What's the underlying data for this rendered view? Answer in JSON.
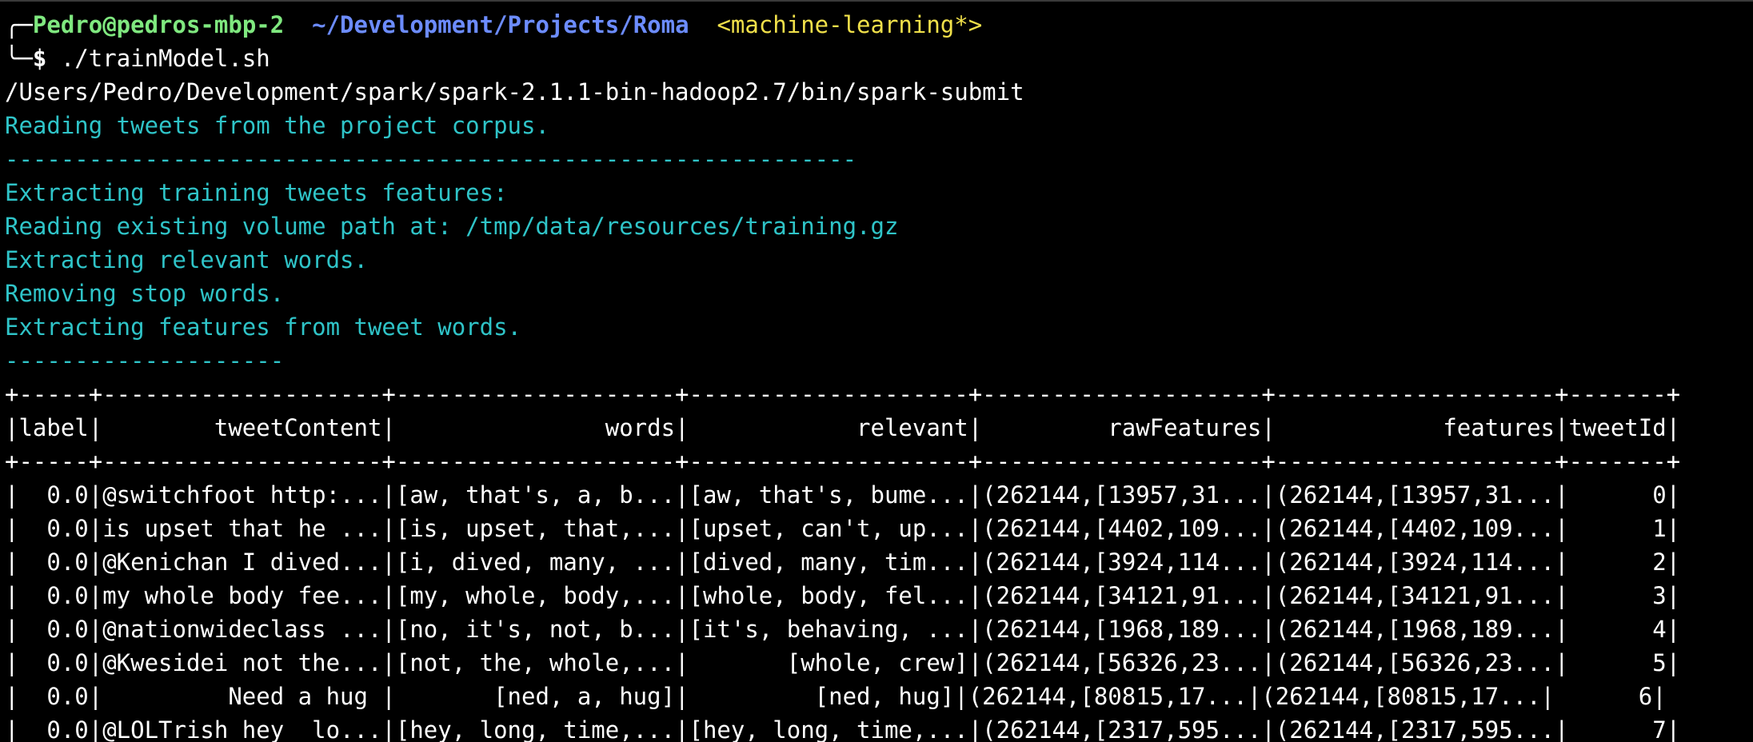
{
  "prompt": {
    "corner_top": "╭─",
    "user_host": "Pedro@pedros-mbp-2",
    "cwd": "~/Development/Projects/Roma",
    "branch": "<machine-learning*>",
    "corner_bottom": "╰─",
    "symbol": "$",
    "command": " ./trainModel.sh"
  },
  "output": {
    "spark_path": "/Users/Pedro/Development/spark/spark-2.1.1-bin-hadoop2.7/bin/spark-submit",
    "lines": [
      "Reading tweets from the project corpus.",
      "-------------------------------------------------------------",
      "Extracting training tweets features:",
      "Reading existing volume path at: /tmp/data/resources/training.gz",
      "Extracting relevant words.",
      "Removing stop words.",
      "Extracting features from tweet words.",
      "--------------------"
    ]
  },
  "table": {
    "border": "+-----+--------------------+--------------------+--------------------+--------------------+--------------------+-------+",
    "header": "|label|        tweetContent|               words|            relevant|         rawFeatures|            features|tweetId|",
    "columns": [
      "label",
      "tweetContent",
      "words",
      "relevant",
      "rawFeatures",
      "features",
      "tweetId"
    ],
    "rows": [
      "|  0.0|@switchfoot http:...|[aw, that's, a, b...|[aw, that's, bume...|(262144,[13957,31...|(262144,[13957,31...|      0|",
      "|  0.0|is upset that he ...|[is, upset, that,...|[upset, can't, up...|(262144,[4402,109...|(262144,[4402,109...|      1|",
      "|  0.0|@Kenichan I dived...|[i, dived, many, ...|[dived, many, tim...|(262144,[3924,114...|(262144,[3924,114...|      2|",
      "|  0.0|my whole body fee...|[my, whole, body,...|[whole, body, fel...|(262144,[34121,91...|(262144,[34121,91...|      3|",
      "|  0.0|@nationwideclass ...|[no, it's, not, b...|[it's, behaving, ...|(262144,[1968,189...|(262144,[1968,189...|      4|",
      "|  0.0|@Kwesidei not the...|[not, the, whole,...|       [whole, crew]|(262144,[56326,23...|(262144,[56326,23...|      5|",
      "|  0.0|         Need a hug |       [ned, a, hug]|         [ned, hug]|(262144,[80815,17...|(262144,[80815,17...|      6|",
      "|  0.0|@LOLTrish hey  lo...|[hey, long, time,...|[hey, long, time,...|(262144,[2317,595...|(262144,[2317,595...|      7|"
    ]
  },
  "colors": {
    "background": "#000000",
    "user": "#7fe87f",
    "path": "#6c8cff",
    "branch": "#f0e04a",
    "info_text": "#2fc4c8",
    "default_text": "#ffffff"
  }
}
